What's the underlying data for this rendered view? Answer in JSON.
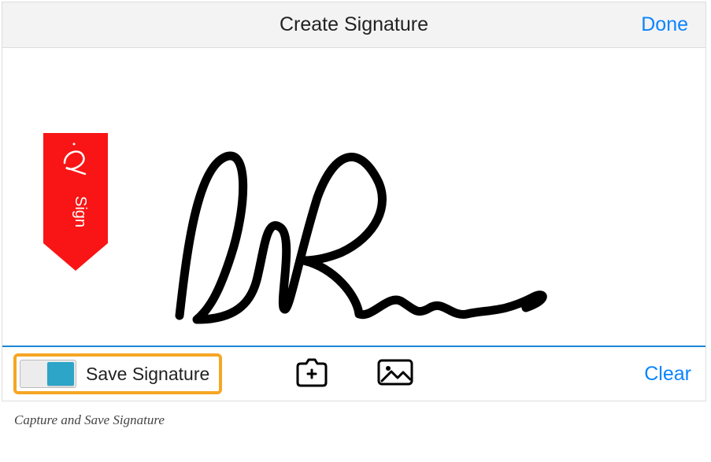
{
  "header": {
    "title": "Create Signature",
    "done_label": "Done"
  },
  "bookmark": {
    "label": "Sign"
  },
  "toolbar": {
    "save_toggle_label": "Save Signature",
    "save_toggle_on": true,
    "clear_label": "Clear"
  },
  "caption": "Capture and Save Signature",
  "colors": {
    "brand_red": "#f91515",
    "accent_blue": "#0a84ff",
    "highlight_orange": "#f5a623",
    "toggle_teal": "#2ca5c9"
  }
}
